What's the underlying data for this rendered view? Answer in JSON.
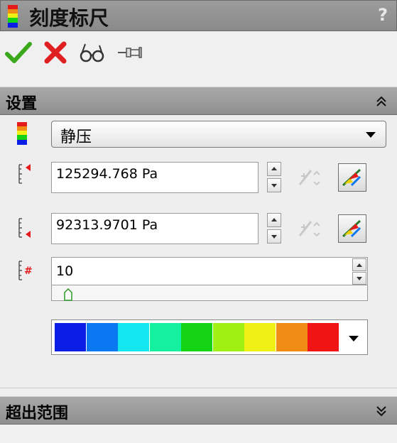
{
  "window": {
    "title": "刻度标尺",
    "help": "?"
  },
  "toolbar": {
    "ok": "ok-check-icon",
    "cancel": "cancel-x-icon",
    "preview": "glasses-icon",
    "pin": "pushpin-icon"
  },
  "settings": {
    "header": "设置",
    "parameter": "静压",
    "max_value": "125294.768 Pa",
    "min_value": "92313.9701 Pa",
    "steps": "10",
    "steps_slider_fraction": 0.02,
    "palette": [
      "#0a1ee6",
      "#0a78f0",
      "#14e6f0",
      "#14f0a0",
      "#14d214",
      "#a0f014",
      "#f0f014",
      "#f08c14",
      "#f01414"
    ]
  },
  "overflow": {
    "header": "超出范围"
  },
  "colors": {
    "accent_red": "#e51b1b",
    "header_gray": "#9a9a9a"
  }
}
